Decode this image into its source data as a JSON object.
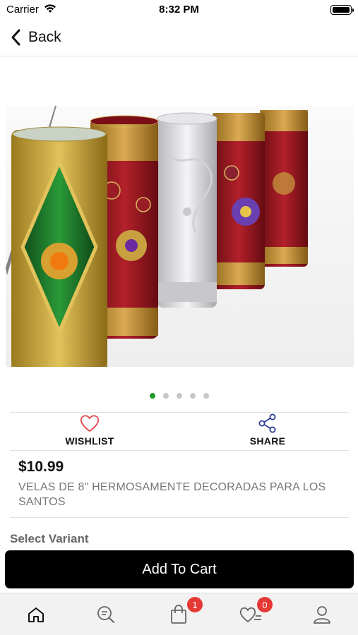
{
  "status_bar": {
    "carrier": "Carrier",
    "time": "8:32 PM"
  },
  "nav": {
    "back_label": "Back"
  },
  "gallery": {
    "image_count": 5,
    "active_index": 0,
    "image_icon": "product-photo-decorated-candles"
  },
  "actions": {
    "wishlist_label": "WISHLIST",
    "share_label": "SHARE"
  },
  "product": {
    "price": "$10.99",
    "title": "VELAS DE 8\" HERMOSAMENTE DECORADAS PARA LOS SANTOS"
  },
  "variant": {
    "label": "Select Variant"
  },
  "cart_button": {
    "label": "Add To Cart"
  },
  "tab_bar": {
    "items": [
      {
        "name": "home",
        "icon": "home-icon"
      },
      {
        "name": "search",
        "icon": "search-list-icon"
      },
      {
        "name": "cart",
        "icon": "bag-icon",
        "badge": "1"
      },
      {
        "name": "wishlist",
        "icon": "heart-list-icon",
        "badge": "0"
      },
      {
        "name": "profile",
        "icon": "user-icon"
      }
    ]
  },
  "colors": {
    "accent_green": "#1d9a2a",
    "badge_red": "#e53935",
    "share_blue": "#2a3b8f",
    "heart_red": "#e0454c"
  }
}
